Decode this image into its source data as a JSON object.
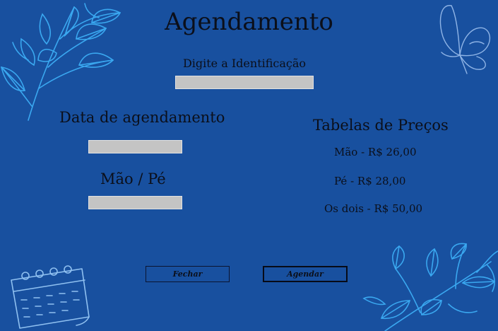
{
  "window": {
    "title": "Agendamento"
  },
  "identification": {
    "label": "Digite a Identificação",
    "value": ""
  },
  "appointment": {
    "date_label": "Data de agendamento",
    "date_value": "",
    "service_label": "Mão / Pé",
    "service_value": ""
  },
  "prices": {
    "heading": "Tabelas de Preços",
    "items": [
      "Mão - R$ 26,00",
      "Pé - R$ 28,00",
      "Os dois - R$ 50,00"
    ]
  },
  "buttons": {
    "close_label": "Fechar",
    "schedule_label": "Agendar"
  },
  "colors": {
    "background": "#18509f",
    "leaf_accent": "#3aa8f0",
    "butterfly": "#8fb4e6",
    "field": "#c4c4c4"
  },
  "decorations": {
    "top_left": "leaf-branch-icon",
    "top_right": "butterfly-icon",
    "bottom_left": "calendar-icon",
    "bottom_right": "leaf-branch-icon"
  }
}
